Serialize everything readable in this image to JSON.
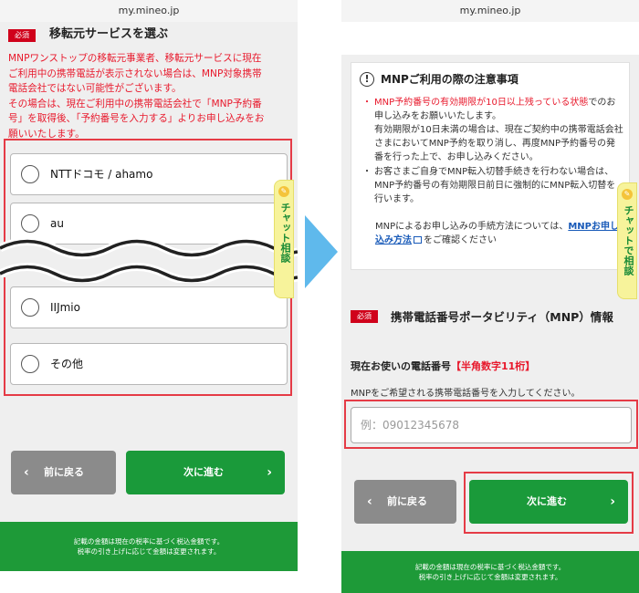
{
  "left": {
    "url": "my.mineo.jp",
    "required_badge": "必須",
    "heading": "移転元サービスを選ぶ",
    "notice_lines": [
      "MNPワンストップの移転元事業者、移転元サービスに現在",
      "ご利用中の携帯電話が表示されない場合は、MNP対象携帯",
      "電話会社ではない可能性がございます。",
      "その場合は、現在ご利用中の携帯電話会社で「MNP予約番",
      "号」を取得後、「予約番号を入力する」よりお申し込みをお",
      "願いいたします。"
    ],
    "options": [
      {
        "label": "NTTドコモ / ahamo"
      },
      {
        "label": "au"
      },
      {
        "label": "IIJmio"
      },
      {
        "label": "その他"
      }
    ],
    "back_label": "前に戻る",
    "next_label": "次に進む",
    "footer_lines": [
      "記載の金額は現在の税率に基づく税込金額です。",
      "税率の引き上げに応じて金額は変更されます。"
    ],
    "chat_label": "チャット相談"
  },
  "right": {
    "url": "my.mineo.jp",
    "notice_title": "MNPご利用の際の注意事項",
    "bullet1_red": "MNP予約番号の有効期限が10日以上残っている状態",
    "bullet1_rest": "でのお申し込みをお願いいたします。",
    "bullet1_detail": "有効期限が10日未満の場合は、現在ご契約中の携帯電話会社さまにおいてMNP予約を取り消し、再度MNP予約番号の発番を行った上で、お申し込みください。",
    "bullet2": "お客さまご自身でMNP転入切替手続きを行わない場合は、MNP予約番号の有効期限日前日に強制的にMNP転入切替を行います。",
    "howto_prefix": "MNPによるお申し込みの手続方法については、",
    "howto_link": "MNPお申し込み方法",
    "howto_suffix": "をご確認ください",
    "required_badge": "必須",
    "section_heading": "携帯電話番号ポータビリティ（MNP）情報",
    "phone_label": "現在お使いの電話番号",
    "phone_label_note": "【半角数字11桁】",
    "phone_help": "MNPをご希望される携帯電話番号を入力してください。",
    "phone_placeholder": "例：09012345678",
    "back_label": "前に戻る",
    "next_label": "次に進む",
    "footer_lines": [
      "記載の金額は現在の税率に基づく税込金額です。",
      "税率の引き上げに応じて金額は変更されます。"
    ],
    "chat_label": "チャットで相談"
  },
  "colors": {
    "accent_green": "#1a9a3a",
    "alert_red": "#e8192c",
    "highlight_red": "#e53b46",
    "arrow_blue": "#5fb9ec",
    "back_gray": "#8b8b8b"
  }
}
